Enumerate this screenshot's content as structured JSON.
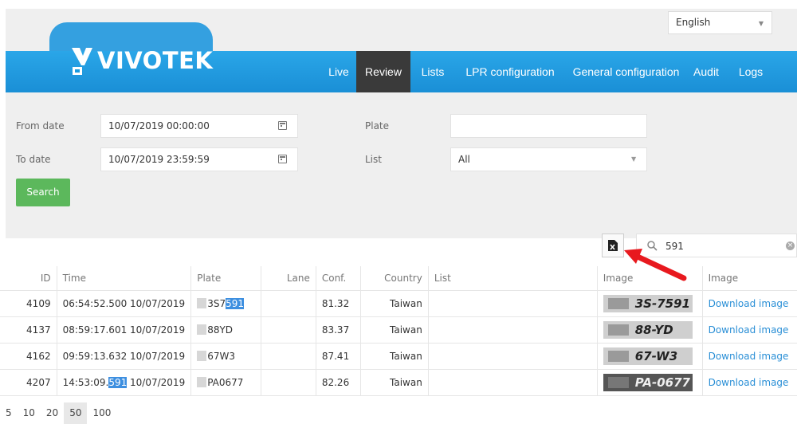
{
  "language": {
    "selected": "English"
  },
  "logo": {
    "text": "VIVOTEK"
  },
  "nav": {
    "items": [
      {
        "label": "Live"
      },
      {
        "label": "Review"
      },
      {
        "label": "Lists"
      },
      {
        "label": "LPR configuration"
      },
      {
        "label": "General configuration"
      },
      {
        "label": "Audit"
      },
      {
        "label": "Logs"
      }
    ],
    "active": "Review"
  },
  "filters": {
    "from_date_label": "From date",
    "from_date_value": "10/07/2019 00:00:00",
    "to_date_label": "To date",
    "to_date_value": "10/07/2019 23:59:59",
    "plate_label": "Plate",
    "plate_value": "",
    "list_label": "List",
    "list_value": "All",
    "search_label": "Search"
  },
  "table_search": {
    "value": "591"
  },
  "icons": {
    "export": "excel-export-icon",
    "search": "search-icon",
    "clear": "clear-icon",
    "calendar": "calendar-icon",
    "annotation": "red-arrow"
  },
  "colors": {
    "brand": "#1a9be0",
    "active_nav": "#3a3a3a",
    "search_button": "#5cb85c",
    "link": "#2a8fd6",
    "highlight": "#3d8fe0",
    "arrow": "#e8191e"
  },
  "table": {
    "headers": [
      "ID",
      "Time",
      "Plate",
      "Lane",
      "Conf.",
      "Country",
      "List",
      "Image",
      "Image"
    ],
    "rows": [
      {
        "id": "4109",
        "time_pre": "06:54:52.500 10/07/2019",
        "time_hl": "",
        "time_post": "",
        "plate_pre": "3S7",
        "plate_hl": "591",
        "lane": "",
        "conf": "81.32",
        "country": "Taiwan",
        "list": "",
        "image_text": "3S-7591",
        "download": "Download image"
      },
      {
        "id": "4137",
        "time_pre": "08:59:17.601 10/07/2019",
        "time_hl": "",
        "time_post": "",
        "plate_pre": "88YD",
        "plate_hl": "",
        "lane": "",
        "conf": "83.37",
        "country": "Taiwan",
        "list": "",
        "image_text": "88-YD",
        "download": "Download image"
      },
      {
        "id": "4162",
        "time_pre": "09:59:13.632 10/07/2019",
        "time_hl": "",
        "time_post": "",
        "plate_pre": "67W3",
        "plate_hl": "",
        "lane": "",
        "conf": "87.41",
        "country": "Taiwan",
        "list": "",
        "image_text": "67-W3",
        "download": "Download image"
      },
      {
        "id": "4207",
        "time_pre": "14:53:09.",
        "time_hl": "591",
        "time_post": " 10/07/2019",
        "plate_pre": "PA0677",
        "plate_hl": "",
        "lane": "",
        "conf": "82.26",
        "country": "Taiwan",
        "list": "",
        "image_text": "PA-0677",
        "download": "Download image"
      }
    ]
  },
  "pagination": {
    "sizes": [
      "5",
      "10",
      "20",
      "50",
      "100"
    ],
    "selected": "50"
  }
}
